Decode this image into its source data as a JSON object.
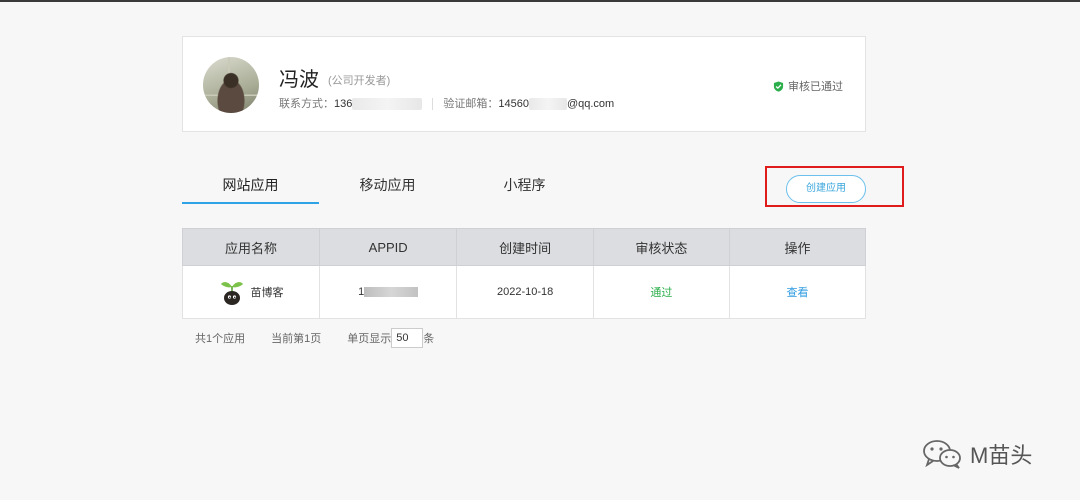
{
  "profile": {
    "name": "冯波",
    "role": "(公司开发者)",
    "contact_label": "联系方式：",
    "contact_value": "136",
    "email_label": "验证邮箱：",
    "email_value_prefix": "14560",
    "email_value_suffix": "@qq.com",
    "approval_status": "审核已通过",
    "approval_icon": "check-shield-icon"
  },
  "tabs": [
    {
      "label": "网站应用",
      "active": true
    },
    {
      "label": "移动应用",
      "active": false
    },
    {
      "label": "小程序",
      "active": false
    }
  ],
  "create_button": "创建应用",
  "table": {
    "headers": [
      "应用名称",
      "APPID",
      "创建时间",
      "审核状态",
      "操作"
    ],
    "rows": [
      {
        "app_name": "苗博客",
        "app_icon": "sprout-icon",
        "appid": "1",
        "created": "2022-10-18",
        "status": "通过",
        "action": "查看"
      }
    ]
  },
  "pager": {
    "total": "共1个应用",
    "current": "当前第1页",
    "page_size_label": "单页显示",
    "page_size": "50",
    "page_size_unit": "条"
  },
  "watermark": {
    "text": "M苗头",
    "icon": "wechat-icon"
  },
  "colors": {
    "accent": "#2fa3e6",
    "success": "#2cae4b",
    "highlight_frame": "#e01b1b"
  }
}
